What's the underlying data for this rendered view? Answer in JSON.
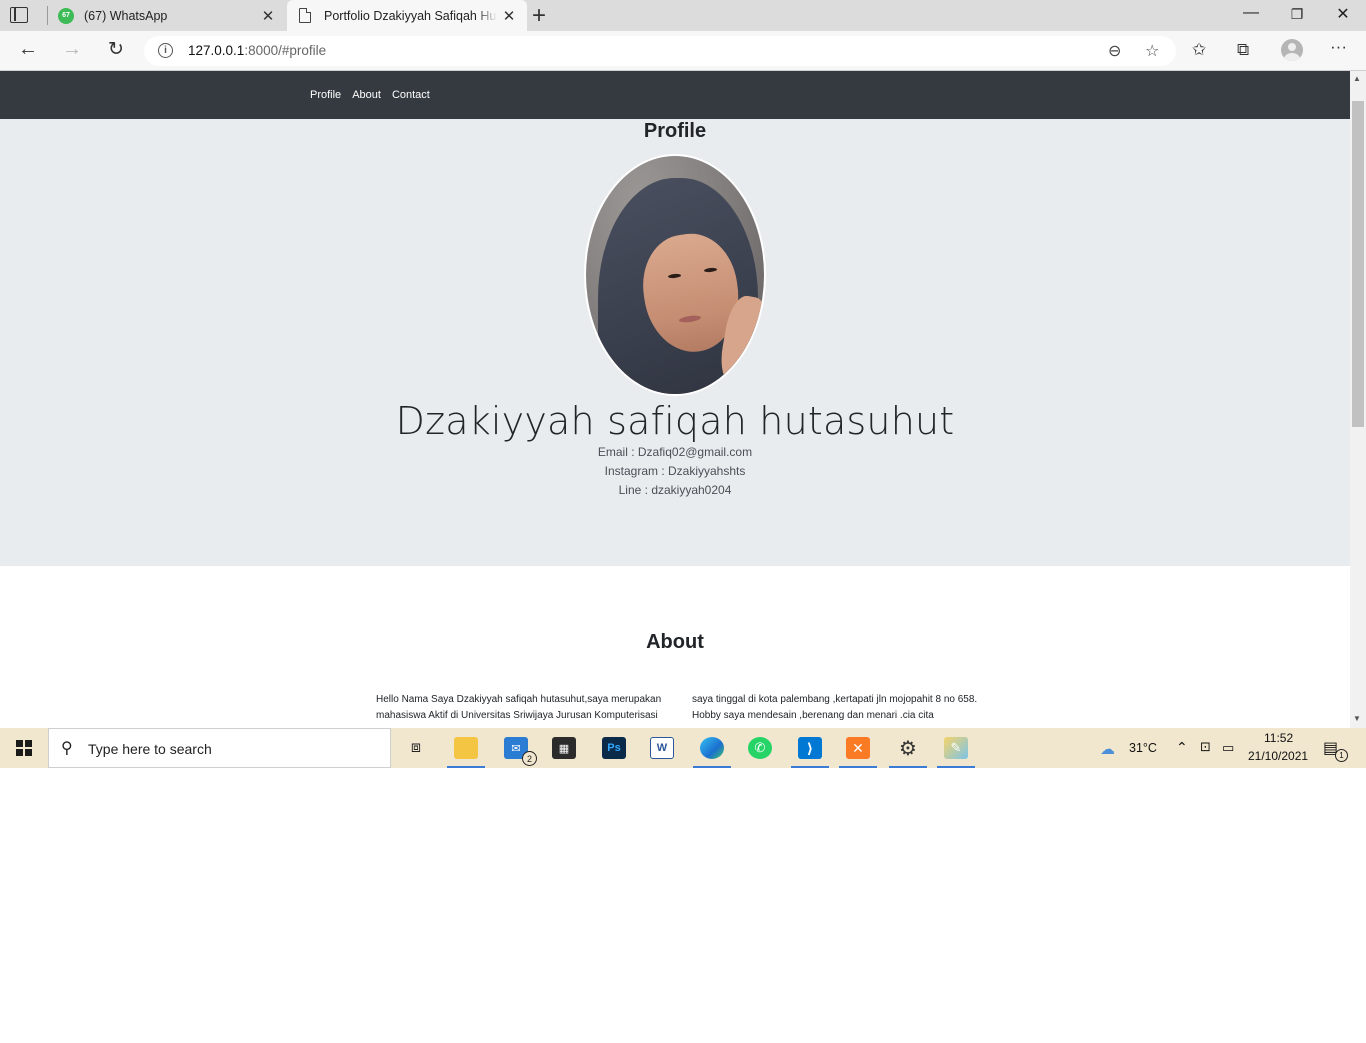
{
  "browser": {
    "tabs": [
      {
        "title": "(67) WhatsApp",
        "badge": "67",
        "icon": "whatsapp-icon"
      },
      {
        "title": "Portfolio Dzakiyyah Safiqah Hutasuhut",
        "icon": "document-icon"
      }
    ],
    "url_host": "127.0.0.1",
    "url_rest": ":8000/#profile"
  },
  "site": {
    "nav": [
      "Profile",
      "About",
      "Contact"
    ],
    "profile": {
      "title": "Profile",
      "name": "Dzakiyyah safiqah hutasuhut",
      "email": "Email : Dzafiq02@gmail.com",
      "instagram": "Instagram : Dzakiyyahshts",
      "line": "Line : dzakiyyah0204"
    },
    "about": {
      "title": "About",
      "left": "Hello Nama Saya Dzakiyyah safiqah hutasuhut,saya merupakan mahasiswa Aktif di Universitas Sriwijaya Jurusan Komputerisasi",
      "right": "saya tinggal di kota palembang ,kertapati jln mojopahit 8 no 658. Hobby saya mendesain ,berenang dan menari .cia cita"
    }
  },
  "taskbar": {
    "search_placeholder": "Type here to search",
    "mail_badge": "2",
    "weather": "31°C",
    "time": "11:52",
    "date": "21/10/2021",
    "notifications": "1"
  },
  "colors": {
    "navbar": "#343a40",
    "jumbotron": "#e9ecef",
    "taskbar": "#f1e6ce",
    "accent": "#3a7bd5"
  }
}
